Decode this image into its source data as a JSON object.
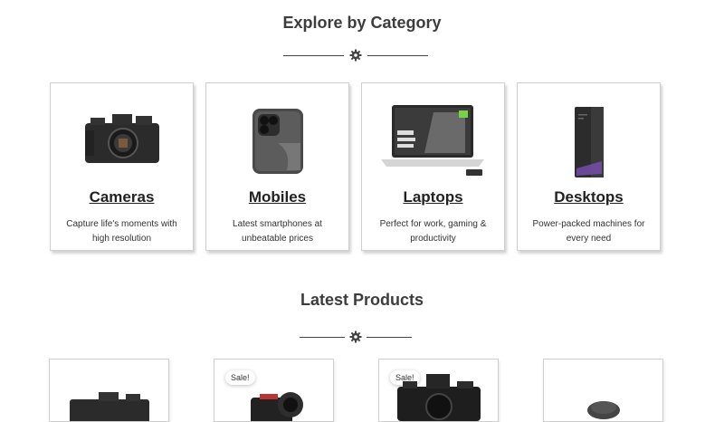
{
  "categories_section": {
    "title": "Explore by Category",
    "divider_icon": "gear-icon",
    "items": [
      {
        "name": "Cameras",
        "description": "Capture life's moments with high resolution",
        "icon": "camera-icon"
      },
      {
        "name": "Mobiles",
        "description": "Latest smartphones at unbeatable prices",
        "icon": "smartphone-icon"
      },
      {
        "name": "Laptops",
        "description": "Perfect for work, gaming & productivity",
        "icon": "laptop-icon"
      },
      {
        "name": "Desktops",
        "description": "Power-packed machines for every need",
        "icon": "desktop-tower-icon"
      }
    ]
  },
  "products_section": {
    "title": "Latest Products",
    "divider_icon": "gear-icon",
    "items": [
      {
        "badge": "",
        "icon": "camera-icon"
      },
      {
        "badge": "Sale!",
        "icon": "action-camera-icon"
      },
      {
        "badge": "Sale!",
        "icon": "camera-icon"
      },
      {
        "badge": "",
        "icon": "microphone-icon"
      }
    ]
  },
  "colors": {
    "accent_text": "#222222",
    "divider": "#444444",
    "card_border": "#cfcfcf"
  }
}
